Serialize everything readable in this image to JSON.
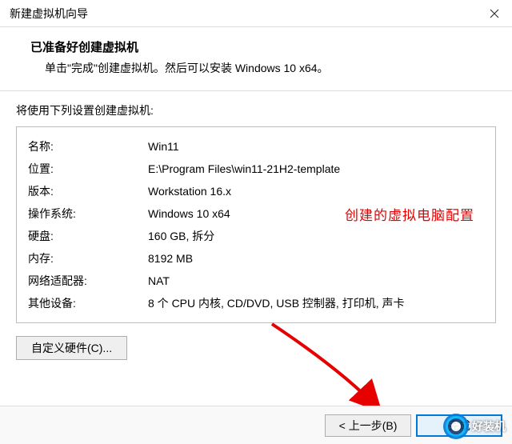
{
  "window": {
    "title": "新建虚拟机向导"
  },
  "header": {
    "title": "已准备好创建虚拟机",
    "subtitle": "单击\"完成\"创建虚拟机。然后可以安装 Windows 10 x64。"
  },
  "settings_intro": "将使用下列设置创建虚拟机:",
  "summary": {
    "rows": [
      {
        "label": "名称:",
        "value": "Win11"
      },
      {
        "label": "位置:",
        "value": "E:\\Program Files\\win11-21H2-template"
      },
      {
        "label": "版本:",
        "value": "Workstation 16.x"
      },
      {
        "label": "操作系统:",
        "value": "Windows 10 x64"
      },
      {
        "label": "",
        "value": ""
      },
      {
        "label": "硬盘:",
        "value": "160 GB, 拆分"
      },
      {
        "label": "内存:",
        "value": "8192 MB"
      },
      {
        "label": "网络适配器:",
        "value": "NAT"
      },
      {
        "label": "其他设备:",
        "value": "8 个 CPU 内核, CD/DVD, USB 控制器, 打印机, 声卡"
      }
    ]
  },
  "annotation": "创建的虚拟电脑配置",
  "buttons": {
    "customize": "自定义硬件(C)...",
    "back": "< 上一步(B)",
    "finish": "完成"
  },
  "watermark": "好装机"
}
